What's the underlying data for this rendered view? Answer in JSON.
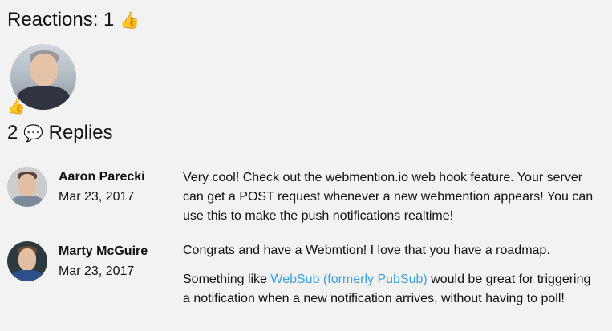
{
  "reactions": {
    "label": "Reactions: 1",
    "emoji": "👍",
    "badge_emoji": "👍"
  },
  "replies": {
    "count": "2",
    "emoji": "💬",
    "label": "Replies"
  },
  "reply_list": [
    {
      "name": "Aaron Parecki",
      "date": "Mar 23, 2017",
      "text": "Very cool! Check out the webmention.io web hook feature. Your server can get a POST request whenever a new webmention appears! You can use this to make the push notifications realtime!"
    },
    {
      "name": "Marty McGuire",
      "date": "Mar 23, 2017",
      "text": "Congrats and have a Webmtion! I love that you have a roadmap.",
      "text2_before": "Something like ",
      "link": "WebSub (formerly PubSub)",
      "text2_after": " would be great for triggering a notification when a new notification arrives, without having to poll!"
    }
  ],
  "colors": {
    "background": "#f2f2f2",
    "link": "#3aa3e3"
  }
}
